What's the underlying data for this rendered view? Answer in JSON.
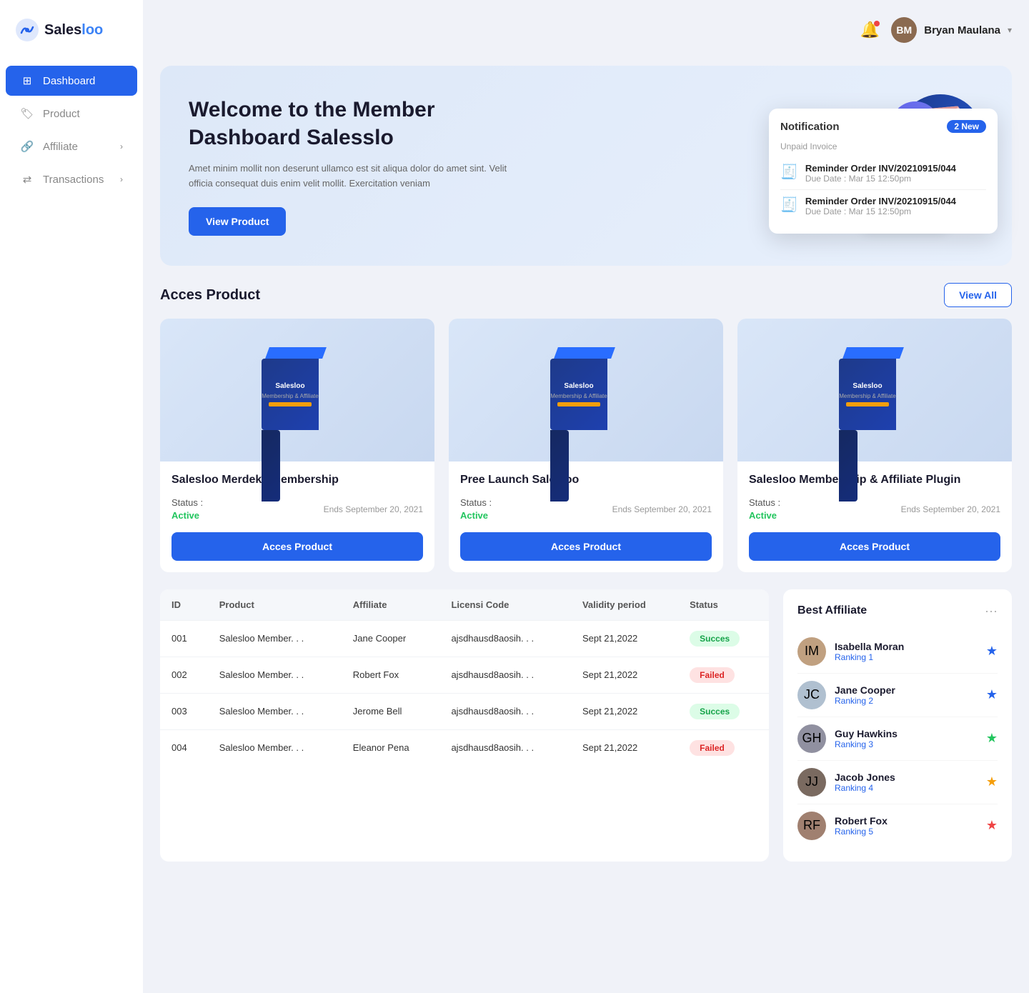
{
  "sidebar": {
    "logo": "Salesloo",
    "logo_accent": "loo",
    "nav_items": [
      {
        "id": "dashboard",
        "label": "Dashboard",
        "active": true,
        "has_arrow": false
      },
      {
        "id": "product",
        "label": "Product",
        "active": false,
        "has_arrow": false
      },
      {
        "id": "affiliate",
        "label": "Affiliate",
        "active": false,
        "has_arrow": true
      },
      {
        "id": "transactions",
        "label": "Transactions",
        "active": false,
        "has_arrow": true
      }
    ]
  },
  "header": {
    "username": "Bryan Maulana",
    "avatar_initials": "BM"
  },
  "hero": {
    "title": "Welcome to the Member Dashboard Salesslo",
    "description": "Amet minim mollit non deserunt ullamco est sit aliqua dolor do amet sint. Velit officia consequat duis enim velit mollit. Exercitation veniam",
    "cta_label": "View Product"
  },
  "notification": {
    "title": "Notification",
    "badge": "2 New",
    "section_title": "Unpaid Invoice",
    "items": [
      {
        "order": "Reminder Order INV/20210915/044",
        "due": "Due Date : Mar 15 12:50pm"
      },
      {
        "order": "Reminder Order INV/20210915/044",
        "due": "Due Date : Mar 15 12:50pm"
      }
    ]
  },
  "access_product": {
    "section_title": "Acces Product",
    "view_all_label": "View All",
    "products": [
      {
        "name": "Salesloo Merdeka Membership",
        "status_label": "Status :",
        "status_value": "Active",
        "ends": "Ends September 20, 2021",
        "cta": "Acces Product"
      },
      {
        "name": "Pree Launch Salesloo",
        "status_label": "Status :",
        "status_value": "Active",
        "ends": "Ends September 20, 2021",
        "cta": "Acces Product"
      },
      {
        "name": "Salesloo Membership & Affiliate Plugin",
        "status_label": "Status :",
        "status_value": "Active",
        "ends": "Ends September 20, 2021",
        "cta": "Acces Product"
      }
    ]
  },
  "table": {
    "columns": [
      "ID",
      "Product",
      "Affiliate",
      "Licensi Code",
      "Validity period",
      "Status"
    ],
    "rows": [
      {
        "id": "001",
        "product": "Salesloo Member. . .",
        "affiliate": "Jane Cooper",
        "license": "ajsdhausd8aosih. . .",
        "validity": "Sept 21,2022",
        "status": "Succes",
        "status_type": "success"
      },
      {
        "id": "002",
        "product": "Salesloo Member. . .",
        "affiliate": "Robert Fox",
        "license": "ajsdhausd8aosih. . .",
        "validity": "Sept 21,2022",
        "status": "Failed",
        "status_type": "failed"
      },
      {
        "id": "003",
        "product": "Salesloo Member. . .",
        "affiliate": "Jerome Bell",
        "license": "ajsdhausd8aosih. . .",
        "validity": "Sept 21,2022",
        "status": "Succes",
        "status_type": "success"
      },
      {
        "id": "004",
        "product": "Salesloo Member. . .",
        "affiliate": "Eleanor Pena",
        "license": "ajsdhausd8aosih. . .",
        "validity": "Sept 21,2022",
        "status": "Failed",
        "status_type": "failed"
      }
    ]
  },
  "best_affiliate": {
    "title": "Best Affiliate",
    "affiliates": [
      {
        "name": "Isabella Moran",
        "rank": "Ranking 1",
        "star_class": "star-blue",
        "star_char": "★",
        "initials": "IM",
        "bg": "#c0a080"
      },
      {
        "name": "Jane Cooper",
        "rank": "Ranking 2",
        "star_class": "star-blue",
        "star_char": "★",
        "initials": "JC",
        "bg": "#b0c0d0"
      },
      {
        "name": "Guy Hawkins",
        "rank": "Ranking 3",
        "star_class": "star-green",
        "star_char": "★",
        "initials": "GH",
        "bg": "#9090a0"
      },
      {
        "name": "Jacob Jones",
        "rank": "Ranking 4",
        "star_class": "star-gold",
        "star_char": "★",
        "initials": "JJ",
        "bg": "#7a6a60"
      },
      {
        "name": "Robert Fox",
        "rank": "Ranking 5",
        "star_class": "star-red",
        "star_char": "★",
        "initials": "RF",
        "bg": "#a08070"
      }
    ]
  }
}
